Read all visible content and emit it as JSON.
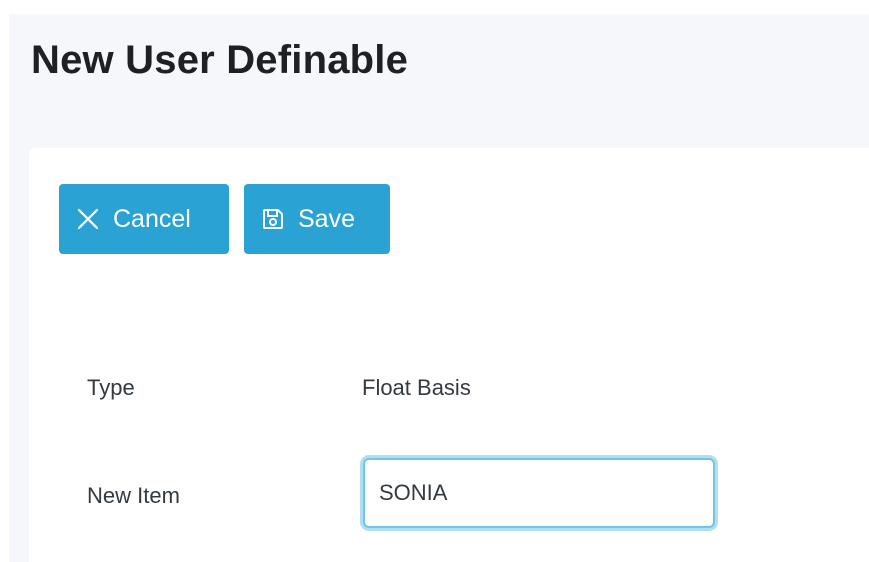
{
  "header": {
    "title": "New User Definable"
  },
  "toolbar": {
    "cancel_label": "Cancel",
    "cancel_icon": "close-icon",
    "save_label": "Save",
    "save_icon": "save-floppy-icon",
    "button_color": "#2aa3d4"
  },
  "form": {
    "type_label": "Type",
    "type_value": "Float Basis",
    "new_item_label": "New Item",
    "new_item_value": "SONIA",
    "focus_color": "#6fc6e6"
  }
}
